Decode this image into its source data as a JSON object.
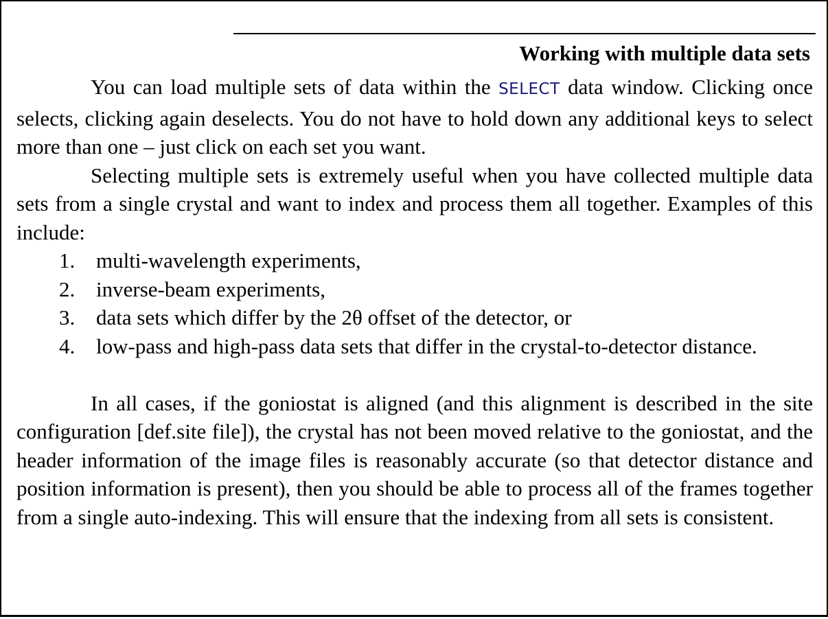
{
  "document": {
    "heading": "Working with multiple data sets",
    "paragraph1": {
      "before_keyword": "You can load multiple sets of data within the ",
      "keyword": "SELECT",
      "after_keyword": " data window. Clicking once selects, clicking again deselects. You do not have to hold down any additional keys to select more than one – just click on each set you want."
    },
    "paragraph2": "Selecting multiple sets is extremely useful when you have collected multiple data sets from a single crystal and want to index and process them all together. Examples of this include:",
    "examples": [
      {
        "number": "1.",
        "text": "multi-wavelength experiments,"
      },
      {
        "number": "2.",
        "text": "inverse-beam experiments,"
      },
      {
        "number": "3.",
        "text": "data sets which differ by the 2θ offset of the detector, or"
      },
      {
        "number": "4.",
        "text": "low-pass and high-pass data sets that differ in the crystal-to-detector distance."
      }
    ],
    "paragraph3": "In all cases, if the goniostat is aligned (and this alignment is described in the site configuration [def.site file]), the crystal has not been moved relative to the goniostat, and the header information of the image files is reasonably accurate (so that detector distance and position information is present), then you should be able to process all of the frames together from a single auto-indexing.  This will ensure that the indexing from all sets is consistent."
  }
}
